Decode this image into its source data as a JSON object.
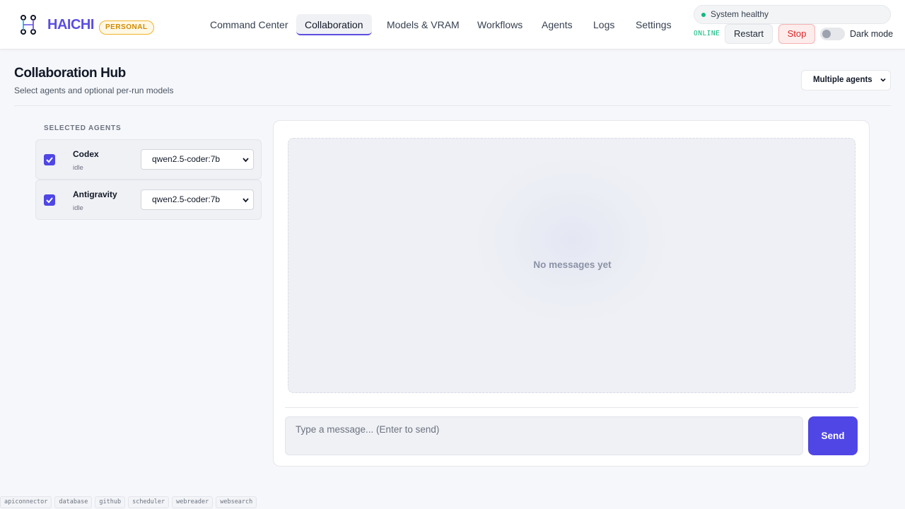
{
  "app": {
    "brand": "HAICHI",
    "plan_badge": "PERSONAL",
    "logo_icon": "workflow-nodes-icon",
    "accent_color": "#5b4ee0"
  },
  "nav": {
    "items": [
      {
        "label": "Command Center",
        "active": false
      },
      {
        "label": "Collaboration",
        "active": true
      },
      {
        "label": "Models & VRAM",
        "active": false
      },
      {
        "label": "Workflows",
        "active": false
      },
      {
        "label": "Agents",
        "active": false
      },
      {
        "label": "Logs",
        "active": false
      },
      {
        "label": "Settings",
        "active": false
      }
    ]
  },
  "status": {
    "health_text": "System healthy",
    "health_color": "#10b981",
    "connection": "ONLINE",
    "restart_label": "Restart",
    "stop_label": "Stop",
    "dark_mode_label": "Dark mode",
    "dark_mode_on": false
  },
  "page": {
    "title": "Collaboration Hub",
    "subtitle": "Select agents and optional per-run models",
    "mode_select": "Multiple agents"
  },
  "agents_panel": {
    "section_label": "SELECTED AGENTS",
    "agents": [
      {
        "name": "Codex",
        "status": "idle",
        "selected": true,
        "model": "qwen2.5-coder:7b"
      },
      {
        "name": "Antigravity",
        "status": "idle",
        "selected": true,
        "model": "qwen2.5-coder:7b"
      }
    ]
  },
  "chat": {
    "empty_text": "No messages yet",
    "input_placeholder": "Type a message... (Enter to send)",
    "input_value": "",
    "send_label": "Send"
  },
  "footer": {
    "tools": [
      "apiconnector",
      "database",
      "github",
      "scheduler",
      "webreader",
      "websearch"
    ]
  }
}
